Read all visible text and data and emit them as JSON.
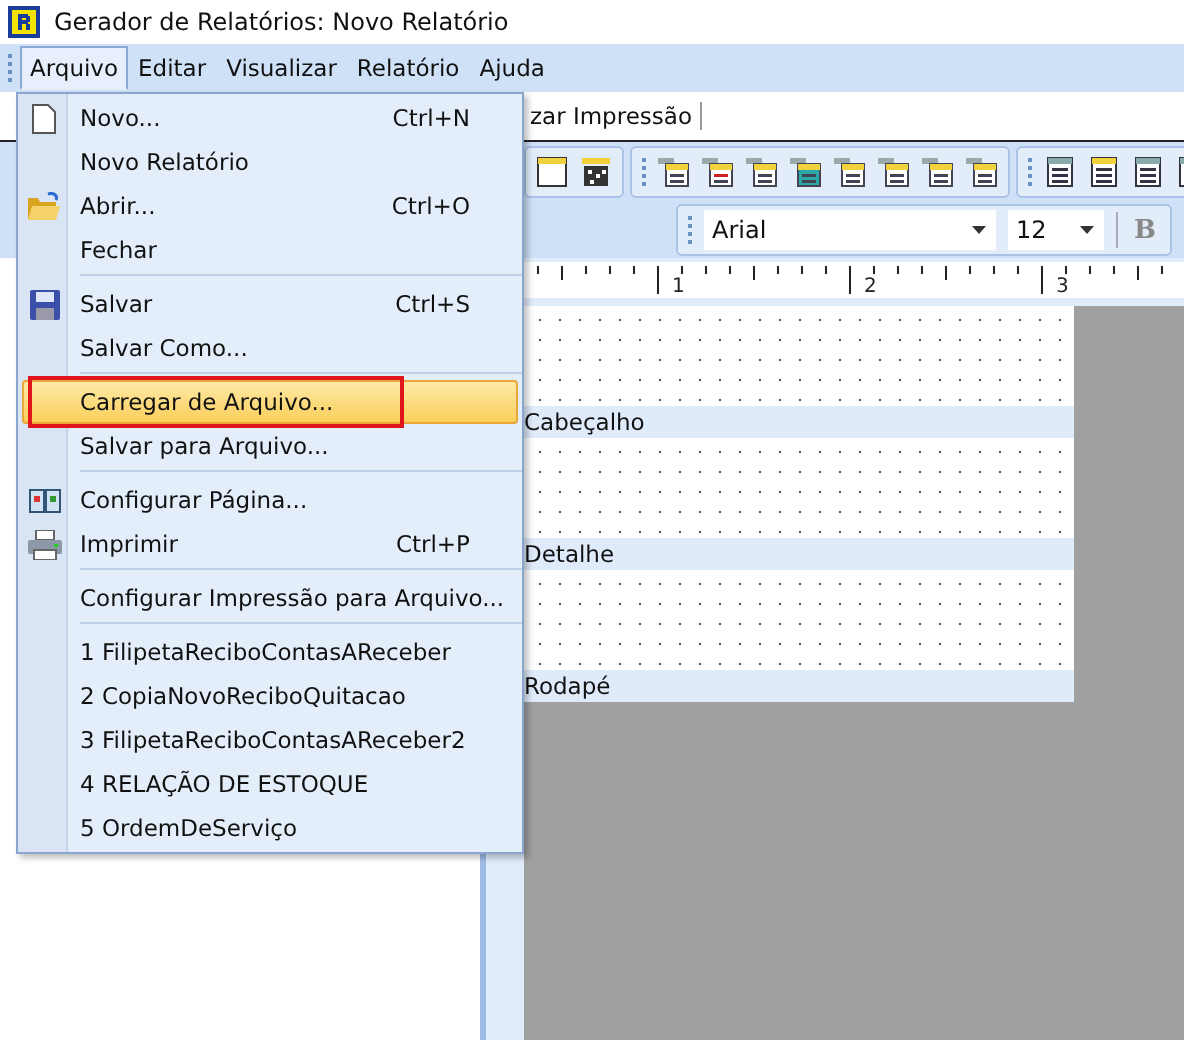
{
  "window": {
    "title": "Gerador de Relatórios: Novo Relatório"
  },
  "menubar": [
    {
      "label": "Arquivo",
      "selected": true
    },
    {
      "label": "Editar",
      "selected": false
    },
    {
      "label": "Visualizar",
      "selected": false
    },
    {
      "label": "Relatório",
      "selected": false
    },
    {
      "label": "Ajuda",
      "selected": false
    }
  ],
  "tab": {
    "label": "zar Impressão"
  },
  "font_toolbar": {
    "font": "Arial",
    "size": "12",
    "bold": "B"
  },
  "ruler": {
    "labels": [
      "1",
      "2",
      "3"
    ]
  },
  "bands": [
    {
      "label": "Cabeçalho"
    },
    {
      "label": "Detalhe"
    },
    {
      "label": "Rodapé"
    }
  ],
  "file_menu": {
    "items": [
      {
        "kind": "item",
        "label": "Novo...",
        "shortcut": "Ctrl+N",
        "selected": false
      },
      {
        "kind": "item",
        "label": "Novo Relatório",
        "selected": false
      },
      {
        "kind": "item",
        "label": "Abrir...",
        "shortcut": "Ctrl+O",
        "selected": false
      },
      {
        "kind": "item",
        "label": "Fechar",
        "selected": false
      },
      {
        "kind": "separator"
      },
      {
        "kind": "item",
        "label": "Salvar",
        "shortcut": "Ctrl+S",
        "selected": false
      },
      {
        "kind": "item",
        "label": "Salvar Como...",
        "selected": false
      },
      {
        "kind": "separator"
      },
      {
        "kind": "item",
        "label": "Carregar de Arquivo...",
        "selected": true
      },
      {
        "kind": "item",
        "label": "Salvar para Arquivo...",
        "selected": false
      },
      {
        "kind": "separator"
      },
      {
        "kind": "item",
        "label": "Configurar Página...",
        "selected": false
      },
      {
        "kind": "item",
        "label": "Imprimir",
        "shortcut": "Ctrl+P",
        "selected": false
      },
      {
        "kind": "separator"
      },
      {
        "kind": "item",
        "label": "Configurar Impressão para Arquivo...",
        "selected": false
      },
      {
        "kind": "separator"
      },
      {
        "kind": "item",
        "label": "1 FilipetaReciboContasAReceber",
        "selected": false
      },
      {
        "kind": "item",
        "label": "2 CopiaNovoReciboQuitacao",
        "selected": false
      },
      {
        "kind": "item",
        "label": "3 FilipetaReciboContasAReceber2",
        "selected": false
      },
      {
        "kind": "item",
        "label": "4 RELAÇÃO DE ESTOQUE",
        "selected": false
      },
      {
        "kind": "item",
        "label": "5 OrdemDeServiço",
        "selected": false
      }
    ]
  }
}
